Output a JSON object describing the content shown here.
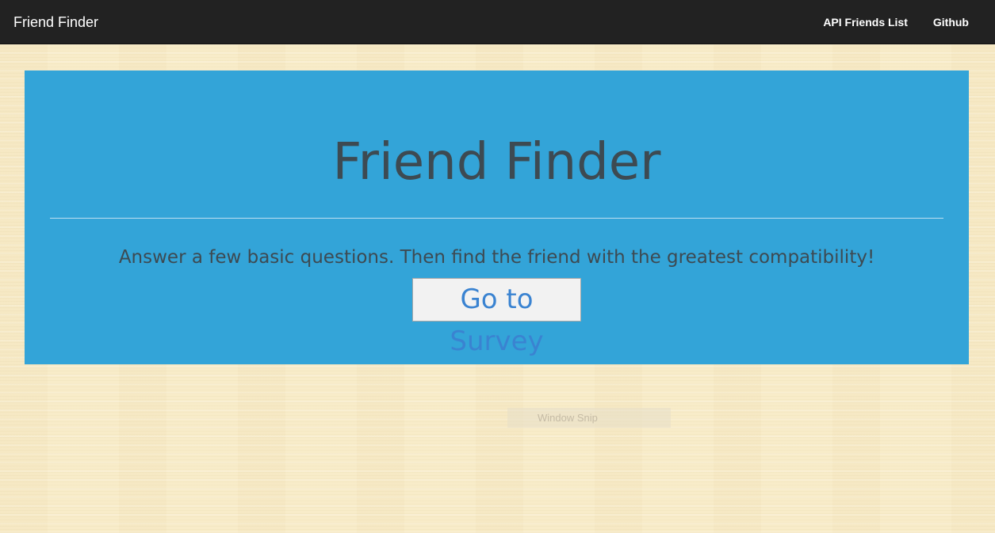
{
  "navbar": {
    "brand": "Friend Finder",
    "links": [
      {
        "label": "API Friends List"
      },
      {
        "label": "Github"
      }
    ]
  },
  "hero": {
    "title": "Friend Finder",
    "lead": "Answer a few basic questions. Then find the friend with the greatest compatibility!",
    "button_label": "Go to Survey",
    "background_color": "#33a4d8"
  },
  "overlay": {
    "label": "Window Snip"
  },
  "colors": {
    "navbar_bg": "#222222",
    "page_bg": "#f8ecc9",
    "button_text": "#3a83d1"
  }
}
